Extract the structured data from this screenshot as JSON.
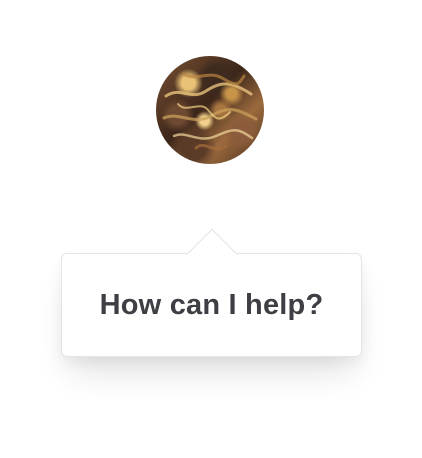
{
  "assistant": {
    "avatar_icon": "assistant-avatar-icon",
    "prompt_text": "How can I help?"
  },
  "colors": {
    "text": "#3d3f44",
    "bubble_border": "#e3e4e6",
    "background": "#ffffff"
  }
}
